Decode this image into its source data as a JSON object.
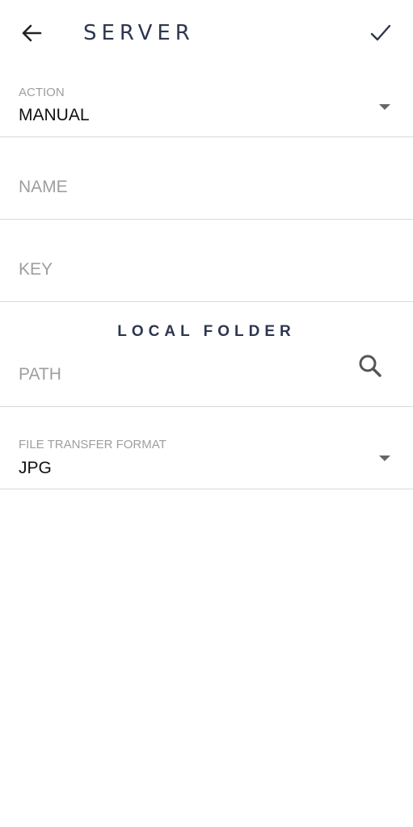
{
  "header": {
    "title": "SERVER",
    "back_icon": "arrow-left-icon",
    "confirm_icon": "check-icon"
  },
  "form": {
    "action": {
      "label": "ACTION",
      "value": "MANUAL"
    },
    "name": {
      "placeholder": "NAME",
      "value": ""
    },
    "key": {
      "placeholder": "KEY",
      "value": ""
    },
    "local_folder": {
      "section_title": "LOCAL FOLDER",
      "path_placeholder": "PATH",
      "path_value": "",
      "search_icon": "search-icon"
    },
    "file_transfer_format": {
      "label": "FILE TRANSFER FORMAT",
      "value": "JPG"
    }
  },
  "colors": {
    "title": "#2e3650",
    "label": "#9e9e9e",
    "divider": "#d9d9d9",
    "icon": "#555555"
  }
}
